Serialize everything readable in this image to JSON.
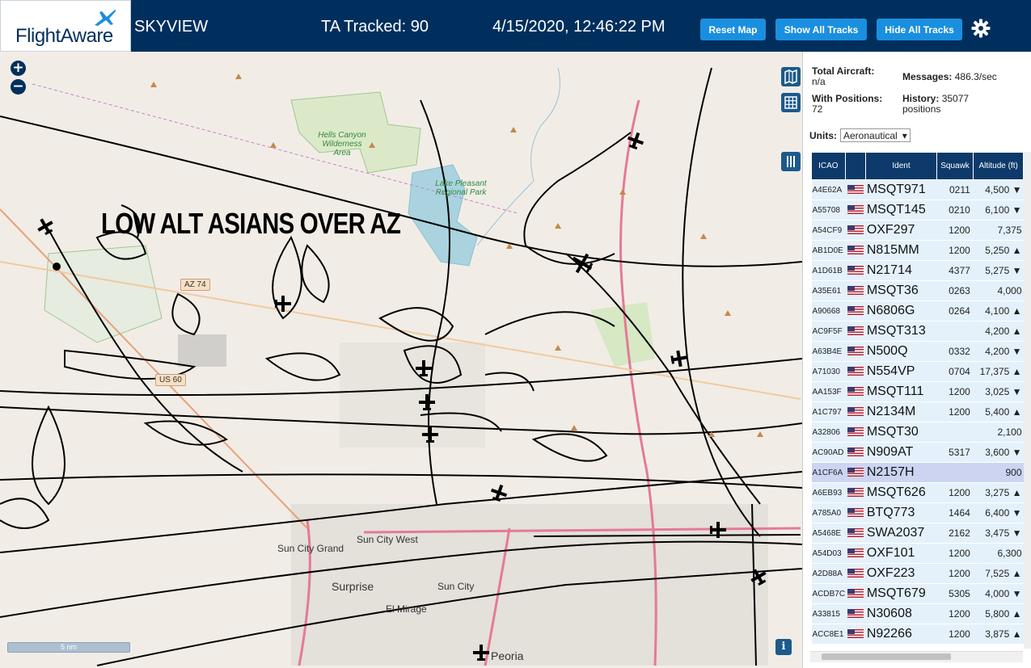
{
  "header": {
    "logo_text": "FlightAware",
    "app_name": "SKYVIEW",
    "tracked_label": "TA Tracked: 90",
    "datetime": "4/15/2020, 12:46:22 PM",
    "reset_map_label": "Reset Map",
    "show_all_label": "Show All Tracks",
    "hide_all_label": "Hide All Tracks"
  },
  "map": {
    "title_annotation": "LOW ALT ASIANS OVER AZ",
    "zoom_in": "+",
    "zoom_out": "−",
    "scale_label": "5 nm",
    "info_label": "i",
    "places": {
      "surprise": "Surprise",
      "sun_city": "Sun City",
      "sun_city_west": "Sun City West",
      "sun_city_grand": "Sun City Grand",
      "el_mirage": "El Mirage",
      "peoria": "Peoria",
      "hells_canyon": "Hells Canyon Wilderness Area",
      "lake_pleasant": "Lake Pleasant Regional Park"
    },
    "roads": {
      "az74": "AZ 74",
      "us60": "US 60"
    },
    "colors": {
      "water": "#aad3df",
      "park": "#cde8b6",
      "highway": "#e47a96",
      "track": "#000000"
    }
  },
  "stats": {
    "total_aircraft_label": "Total Aircraft:",
    "total_aircraft_value": "n/a",
    "with_positions_label": "With Positions:",
    "with_positions_value": "72",
    "messages_label": "Messages:",
    "messages_value": "486.3/sec",
    "history_label": "History:",
    "history_value": "35077",
    "history_unit": "positions",
    "units_label": "Units:",
    "units_value": "Aeronautical"
  },
  "table": {
    "headers": [
      "ICAO",
      "",
      "Ident",
      "Squawk",
      "Altitude (ft)"
    ],
    "rows": [
      {
        "icao": "A4E62A",
        "ident": "MSQT971",
        "squawk": "0211",
        "alt": "4,500 ▼"
      },
      {
        "icao": "A55708",
        "ident": "MSQT145",
        "squawk": "0210",
        "alt": "6,100 ▼"
      },
      {
        "icao": "A54CF9",
        "ident": "OXF297",
        "squawk": "1200",
        "alt": "7,375"
      },
      {
        "icao": "AB1D0E",
        "ident": "N815MM",
        "squawk": "1200",
        "alt": "5,250 ▲"
      },
      {
        "icao": "A1D61B",
        "ident": "N21714",
        "squawk": "4377",
        "alt": "5,275 ▼"
      },
      {
        "icao": "A35E61",
        "ident": "MSQT36",
        "squawk": "0263",
        "alt": "4,000"
      },
      {
        "icao": "A90668",
        "ident": "N6806G",
        "squawk": "0264",
        "alt": "4,100 ▲"
      },
      {
        "icao": "AC9F5F",
        "ident": "MSQT313",
        "squawk": "",
        "alt": "4,200 ▲"
      },
      {
        "icao": "A63B4E",
        "ident": "N500Q",
        "squawk": "0332",
        "alt": "4,200 ▼"
      },
      {
        "icao": "A71030",
        "ident": "N554VP",
        "squawk": "0704",
        "alt": "17,375 ▲"
      },
      {
        "icao": "AA153F",
        "ident": "MSQT111",
        "squawk": "1200",
        "alt": "3,025 ▼"
      },
      {
        "icao": "A1C797",
        "ident": "N2134M",
        "squawk": "1200",
        "alt": "5,400 ▲"
      },
      {
        "icao": "A32806",
        "ident": "MSQT30",
        "squawk": "",
        "alt": "2,100"
      },
      {
        "icao": "AC90AD",
        "ident": "N909AT",
        "squawk": "5317",
        "alt": "3,600 ▼"
      },
      {
        "icao": "A1CF6A",
        "ident": "N2157H",
        "squawk": "",
        "alt": "900"
      },
      {
        "icao": "A6EB93",
        "ident": "MSQT626",
        "squawk": "1200",
        "alt": "3,275 ▲"
      },
      {
        "icao": "A785A0",
        "ident": "BTQ773",
        "squawk": "1464",
        "alt": "6,400 ▼"
      },
      {
        "icao": "A5468E",
        "ident": "SWA2037",
        "squawk": "2162",
        "alt": "3,475 ▼"
      },
      {
        "icao": "A54D03",
        "ident": "OXF101",
        "squawk": "1200",
        "alt": "6,300"
      },
      {
        "icao": "A2D88A",
        "ident": "OXF223",
        "squawk": "1200",
        "alt": "7,525 ▲"
      },
      {
        "icao": "ACDB7C",
        "ident": "MSQT679",
        "squawk": "5305",
        "alt": "4,000 ▼"
      },
      {
        "icao": "A33815",
        "ident": "N30608",
        "squawk": "1200",
        "alt": "5,800 ▲"
      },
      {
        "icao": "ACC8E1",
        "ident": "N92266",
        "squawk": "1200",
        "alt": "3,875 ▲"
      }
    ]
  }
}
